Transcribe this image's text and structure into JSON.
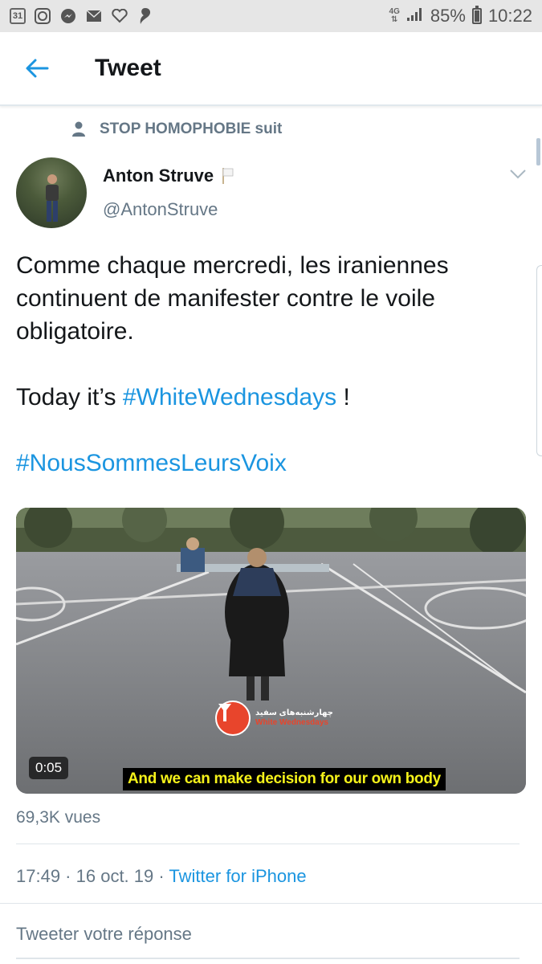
{
  "status_bar": {
    "calendar_day": "31",
    "network": "4G",
    "battery": "85%",
    "time": "10:22",
    "icons": [
      "calendar-icon",
      "whatsapp-icon",
      "messenger-icon",
      "mail-icon",
      "heart-icon",
      "cloud-icon",
      "signal-icon",
      "battery-icon"
    ]
  },
  "header": {
    "title": "Tweet"
  },
  "social_context": {
    "text": "STOP HOMOPHOBIE suit"
  },
  "author": {
    "name": "Anton Struve",
    "handle": "@AntonStruve",
    "flag_emoji": "🏳"
  },
  "tweet": {
    "line1": "Comme chaque mercredi, les iraniennes continuent de manifester contre le voile obligatoire.",
    "line2_prefix": "Today it’s ",
    "hashtag1": "#WhiteWednesdays",
    "line2_suffix": " !",
    "hashtag2": "#NousSommesLeursVoix"
  },
  "video": {
    "duration": "0:05",
    "subtitle": "And we can make decision for our own body",
    "watermark_title": "چهارشنبه‌های سفید",
    "watermark_sub": "White Wednesdays"
  },
  "stats": {
    "views": "69,3K vues"
  },
  "meta": {
    "time": "17:49",
    "date": "16 oct. 19",
    "separator": " · ",
    "source": "Twitter for iPhone"
  },
  "reply": {
    "placeholder": "Tweeter votre réponse"
  },
  "colors": {
    "accent": "#1b95e0",
    "secondary_text": "#657786",
    "primary_text": "#14171a"
  }
}
